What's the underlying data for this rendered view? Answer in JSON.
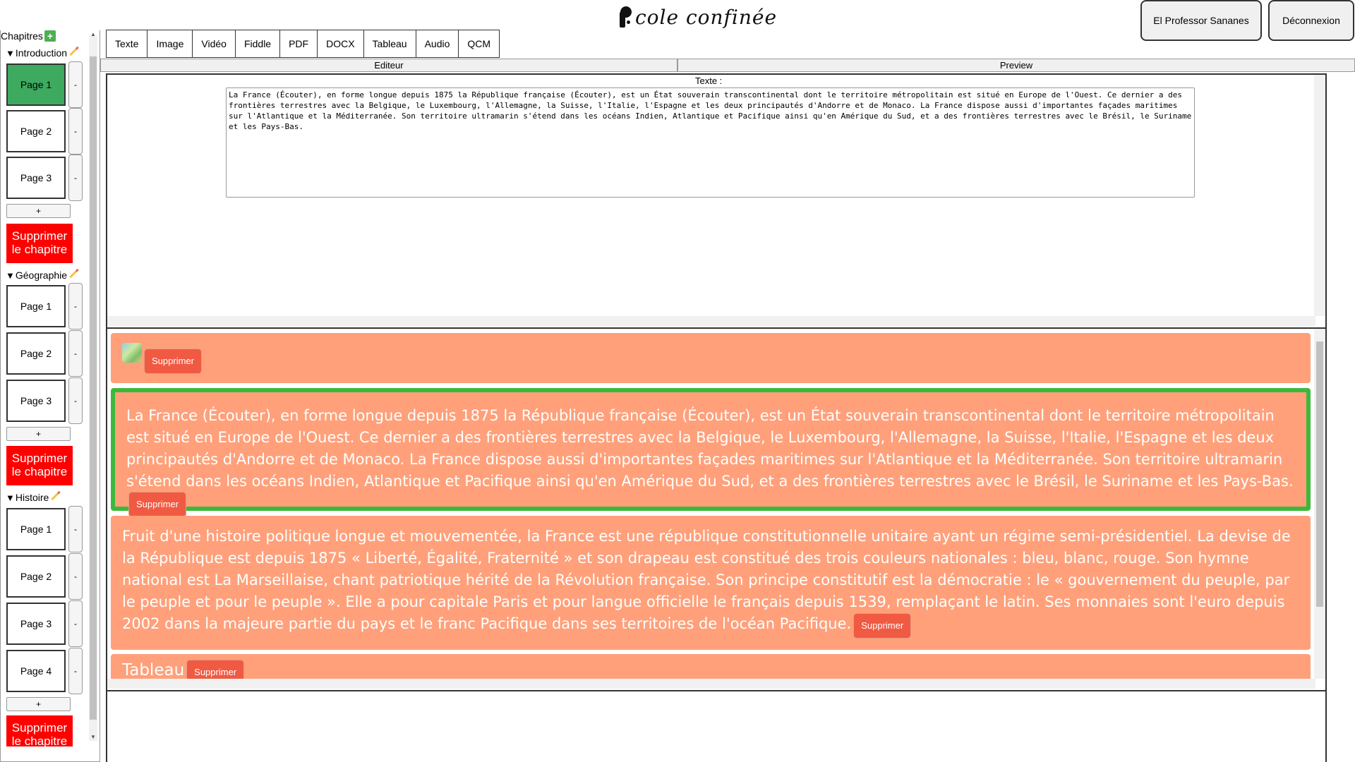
{
  "header": {
    "logo_text": "cole confinée",
    "user_button": "El Professor Sananes",
    "logout_button": "Déconnexion"
  },
  "sidebar": {
    "title": "Chapitres",
    "add_chapter_icon": "+",
    "add_page_label": "+",
    "remove_page_label": "-",
    "delete_chapter_label": "Supprimer le chapitre",
    "chapters": [
      {
        "name": "Introduction",
        "pages": [
          "Page 1",
          "Page 2",
          "Page 3"
        ],
        "active_page": 0
      },
      {
        "name": "Géographie",
        "pages": [
          "Page 1",
          "Page 2",
          "Page 3"
        ]
      },
      {
        "name": "Histoire",
        "pages": [
          "Page 1",
          "Page 2",
          "Page 3",
          "Page 4"
        ]
      }
    ]
  },
  "toolbar": {
    "buttons": [
      "Texte",
      "Image",
      "Vidéo",
      "Fiddle",
      "PDF",
      "DOCX",
      "Tableau",
      "Audio",
      "QCM"
    ]
  },
  "tabs": {
    "editor": "Editeur",
    "preview": "Preview"
  },
  "editor": {
    "label": "Texte :",
    "value": "La France (Écouter), en forme longue depuis 1875 la République française (Écouter), est un État souverain transcontinental dont le territoire métropolitain est situé en Europe de l'Ouest. Ce dernier a des frontières terrestres avec la Belgique, le Luxembourg, l'Allemagne, la Suisse, l'Italie, l'Espagne et les deux principautés d'Andorre et de Monaco. La France dispose aussi d'importantes façades maritimes sur l'Atlantique et la Méditerranée. Son territoire ultramarin s'étend dans les océans Indien, Atlantique et Pacifique ainsi qu'en Amérique du Sud, et a des frontières terrestres avec le Brésil, le Suriname et les Pays-Bas."
  },
  "preview": {
    "delete_label": "Supprimer",
    "block_texte1": "La France (Écouter), en forme longue depuis 1875 la République française (Écouter), est un État souverain transcontinental dont le territoire métropolitain est situé en Europe de l'Ouest. Ce dernier a des frontières terrestres avec la Belgique, le Luxembourg, l'Allemagne, la Suisse, l'Italie, l'Espagne et les deux principautés d'Andorre et de Monaco. La France dispose aussi d'importantes façades maritimes sur l'Atlantique et la Méditerranée. Son territoire ultramarin s'étend dans les océans Indien, Atlantique et Pacifique ainsi qu'en Amérique du Sud, et a des frontières terrestres avec le Brésil, le Suriname et les Pays-Bas.",
    "block_texte2": "Fruit d'une histoire politique longue et mouvementée, la France est une république constitutionnelle unitaire ayant un régime semi-présidentiel. La devise de la République est depuis 1875 « Liberté, Égalité, Fraternité » et son drapeau est constitué des trois couleurs nationales : bleu, blanc, rouge. Son hymne national est La Marseillaise, chant patriotique hérité de la Révolution française. Son principe constitutif est la démocratie : le « gouvernement du peuple, par le peuple et pour le peuple ». Elle a pour capitale Paris et pour langue officielle le français depuis 1539, remplaçant le latin. Ses monnaies sont l'euro depuis 2002 dans la majeure partie du pays et le franc Pacifique dans ses territoires de l'océan Pacifique.",
    "block_tableau": "Tableau"
  },
  "colors": {
    "active_page": "#3daa5f",
    "delete_chapter": "#ff0000",
    "block_bg": "#ffa07a",
    "selected_border": "#3cb93c",
    "delete_button": "#f05a42"
  }
}
